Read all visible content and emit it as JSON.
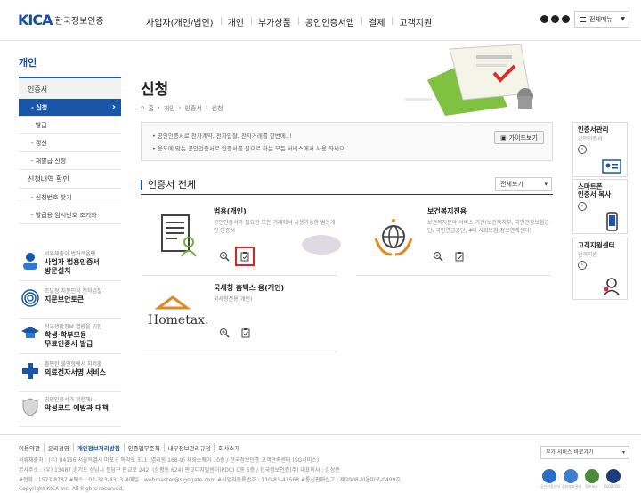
{
  "header": {
    "logo_mark": "KICA",
    "logo_text": "한국정보인증",
    "nav": [
      "사업자(개인/법인)",
      "개인",
      "부가상품",
      "공인인증서앱",
      "결제",
      "고객지원"
    ],
    "all_menu": "전체메뉴"
  },
  "lnb": {
    "title": "개인",
    "category": "인증서",
    "items": [
      "- 신청",
      "- 발급",
      "- 갱신",
      "- 재발급 신청"
    ],
    "category2": "신청내역 확인",
    "items2": [
      "- 신청번호 찾기",
      "- 발급용 임시번호 조기화"
    ]
  },
  "promos": [
    {
      "l1": "서류제출이 번거로울땐",
      "l2": "사업자 법용인증서",
      "l3": "방문설치"
    },
    {
      "l1": "조달청 지문인식 전자입찰",
      "l2": "지문보안토큰",
      "l3": ""
    },
    {
      "l1": "학교생활정보 열람을 위한",
      "l2": "학생·학부모용",
      "l3": "무료인증서 발급"
    },
    {
      "l1": "볼편한 불안함에서 지켜줄",
      "l2": "의료전자서명 서비스",
      "l3": ""
    },
    {
      "l1": "공인인증서가 위험해!",
      "l2": "악성코드 예방과 대책",
      "l3": ""
    }
  ],
  "main": {
    "title": "신청",
    "breadcrumb": [
      "홈",
      "개인",
      "인증서",
      "신청"
    ],
    "notices": [
      "공인인증서로 전자계약, 전자입찰, 전자거래를 한번에..!",
      "용도에 맞는 공인인증서로 인증서를 필요로 하는 모든 서비스에서 사용 하세요."
    ],
    "guide_button": "가이드보기",
    "section_title": "인증서 전체",
    "filter": "전체보기",
    "cards": [
      {
        "title": "범용(개인)",
        "desc": "공인인증서가 필요한 모든 거래에서 사용가능한 범용개인 인증서"
      },
      {
        "title": "보건복지전용",
        "desc": "보건복지분야 서비스 기관(보건복지부, 국민건강보험공단, 국민연금공단, 4대 사회보험 정보연계센터)"
      },
      {
        "title": "국세청 홈택스 용(개인)",
        "desc": "국세청전용(개인)"
      }
    ],
    "hometax_logo": "Hometax."
  },
  "quick": [
    {
      "title": "인증서관리",
      "sub": "공인인증서"
    },
    {
      "title": "스마트폰\n인증서 복사",
      "sub": ""
    },
    {
      "title": "고객지원센터",
      "sub": "원격지원"
    }
  ],
  "footer": {
    "links": [
      "이용약관",
      "윤리경영",
      "개인정보처리방침",
      "인증업무준칙",
      "내부정보관리규정",
      "회사소개"
    ],
    "addr1": "서류제출처 : (우) 04156 서울특별시 마포구 독막로 311 (염리동 168-9) 재화스퀘어 10층 / 한국정보인증 고객만족센터 (SG서비스)",
    "addr2": "본사주소 : (우) 13487 경기도 성남시 분당구 판교로 242, (삼평동 624) 판교디지털센터(PDC) C동 5층 / 한국정보인증(주) 대표이사 : 김상준",
    "addr3": "#전화 : 1577-8787  #팩스 : 02-323-8313  #메일 : webmaster@signgate.com  #사업자등록번호 : 110-81-41568  #통신판매신고 : 제2008-서울마포-0499호",
    "copyright": "Copyright KICA Inc. All Rights reserved.",
    "family_site": "부가 서비스 바로가기",
    "badges": [
      "공인인증센터",
      "정보보호관리",
      "정보보호",
      "ISO27001"
    ]
  },
  "colors": {
    "accent": "#1a56a8",
    "highlight": "#e02020"
  }
}
